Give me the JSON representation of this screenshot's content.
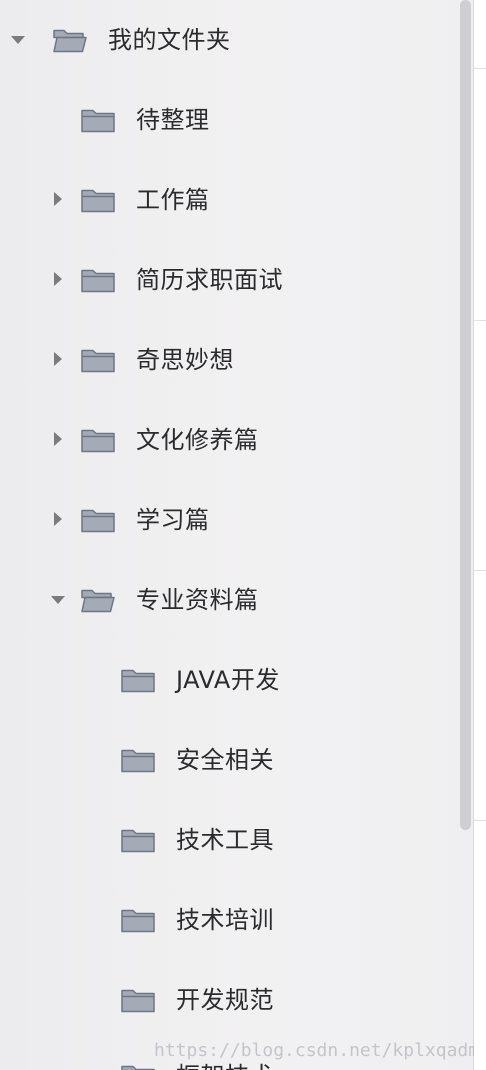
{
  "sidebar": {
    "items": [
      {
        "label": "我的文件夹",
        "icon": "folder-open-icon",
        "toggle": "expanded"
      },
      {
        "label": "待整理",
        "icon": "folder-icon",
        "toggle": "none"
      },
      {
        "label": "工作篇",
        "icon": "folder-icon",
        "toggle": "collapsed"
      },
      {
        "label": "简历求职面试",
        "icon": "folder-icon",
        "toggle": "collapsed"
      },
      {
        "label": "奇思妙想",
        "icon": "folder-icon",
        "toggle": "collapsed"
      },
      {
        "label": "文化修养篇",
        "icon": "folder-icon",
        "toggle": "collapsed"
      },
      {
        "label": "学习篇",
        "icon": "folder-icon",
        "toggle": "collapsed"
      },
      {
        "label": "专业资料篇",
        "icon": "folder-open-icon",
        "toggle": "expanded"
      },
      {
        "label": "JAVA开发",
        "icon": "folder-icon",
        "toggle": "none"
      },
      {
        "label": "安全相关",
        "icon": "folder-icon",
        "toggle": "none"
      },
      {
        "label": "技术工具",
        "icon": "folder-icon",
        "toggle": "none"
      },
      {
        "label": "技术培训",
        "icon": "folder-icon",
        "toggle": "none"
      },
      {
        "label": "开发规范",
        "icon": "folder-icon",
        "toggle": "none"
      },
      {
        "label": "框架技术",
        "icon": "folder-icon",
        "toggle": "none"
      }
    ]
  },
  "watermark": {
    "text": "https://blog.csdn.net/kplxqadmin"
  },
  "colors": {
    "sidebar_background": "#efeff1",
    "folder_fill": "#a4abb6",
    "folder_stroke": "#6f7683",
    "text": "#2b2b2d",
    "toggle": "#7b7b7d"
  }
}
